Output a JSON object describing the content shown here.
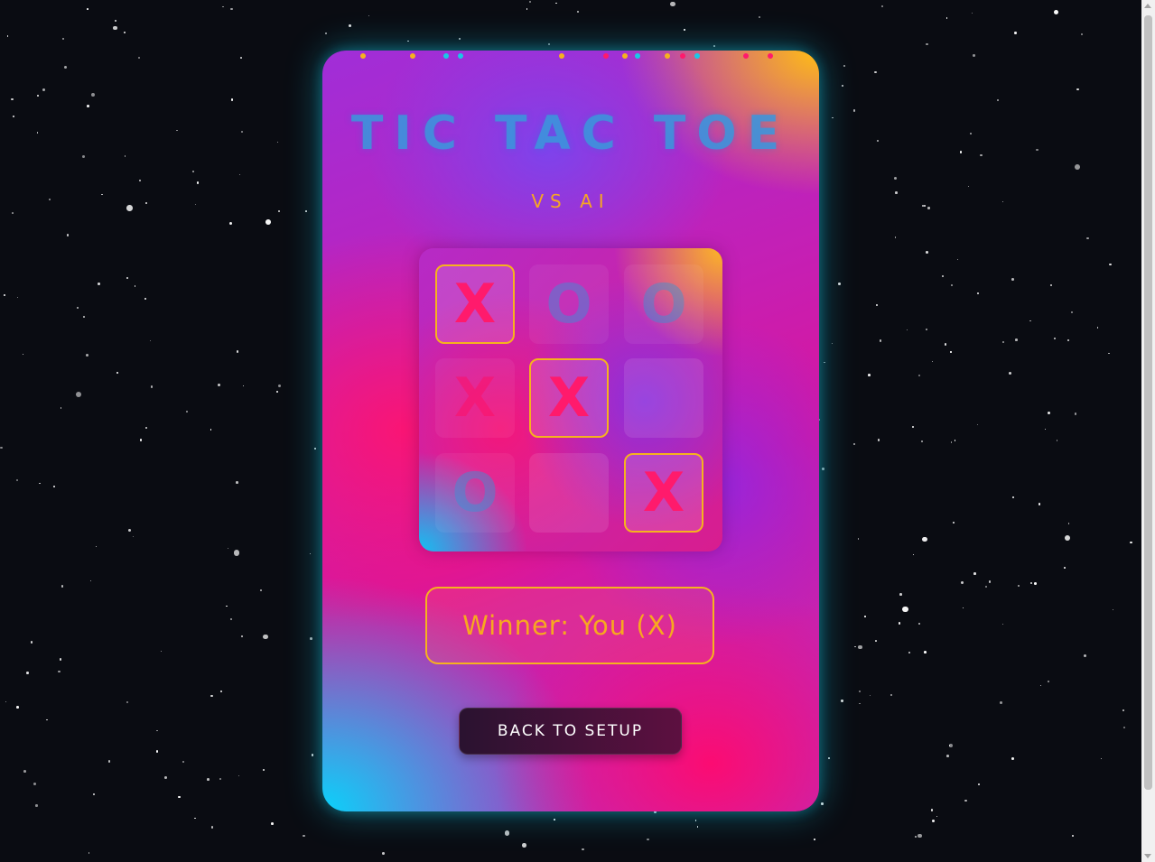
{
  "app": {
    "title": "TIC TAC TOE",
    "subtitle": "VS AI"
  },
  "board": {
    "cells": [
      {
        "mark": "X",
        "winning": true
      },
      {
        "mark": "O",
        "winning": false
      },
      {
        "mark": "O",
        "winning": false
      },
      {
        "mark": "X",
        "winning": false
      },
      {
        "mark": "X",
        "winning": true
      },
      {
        "mark": "",
        "winning": false
      },
      {
        "mark": "O",
        "winning": false
      },
      {
        "mark": "",
        "winning": false
      },
      {
        "mark": "X",
        "winning": true
      }
    ]
  },
  "status": {
    "text": "Winner: You (X)"
  },
  "actions": {
    "back_label": "BACK TO SETUP"
  },
  "colors": {
    "x_mark": "#ff1a6c",
    "o_mark": "#32a0dc",
    "accent": "#f6b21e",
    "background": "#0a0c12"
  }
}
